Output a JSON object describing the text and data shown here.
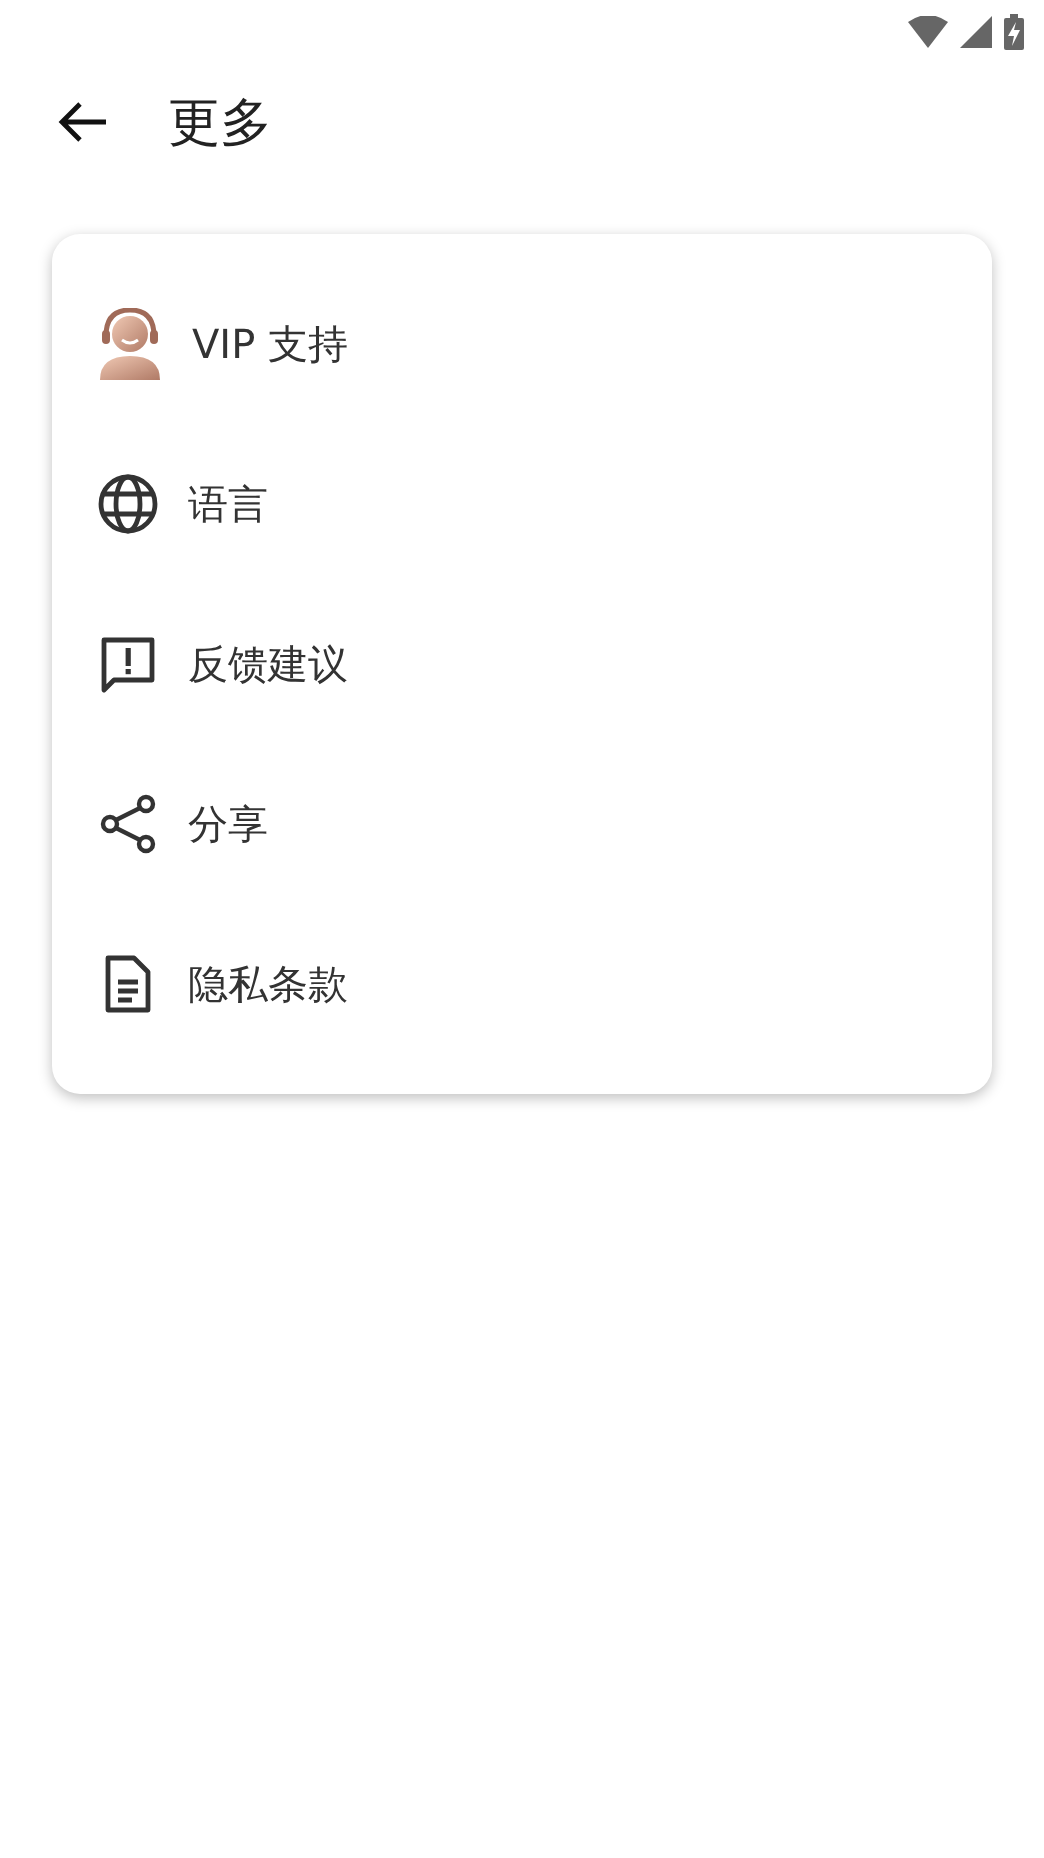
{
  "header": {
    "title": "更多"
  },
  "menu": [
    {
      "label": "VIP 支持"
    },
    {
      "label": "语言"
    },
    {
      "label": "反馈建议"
    },
    {
      "label": "分享"
    },
    {
      "label": "隐私条款"
    }
  ]
}
